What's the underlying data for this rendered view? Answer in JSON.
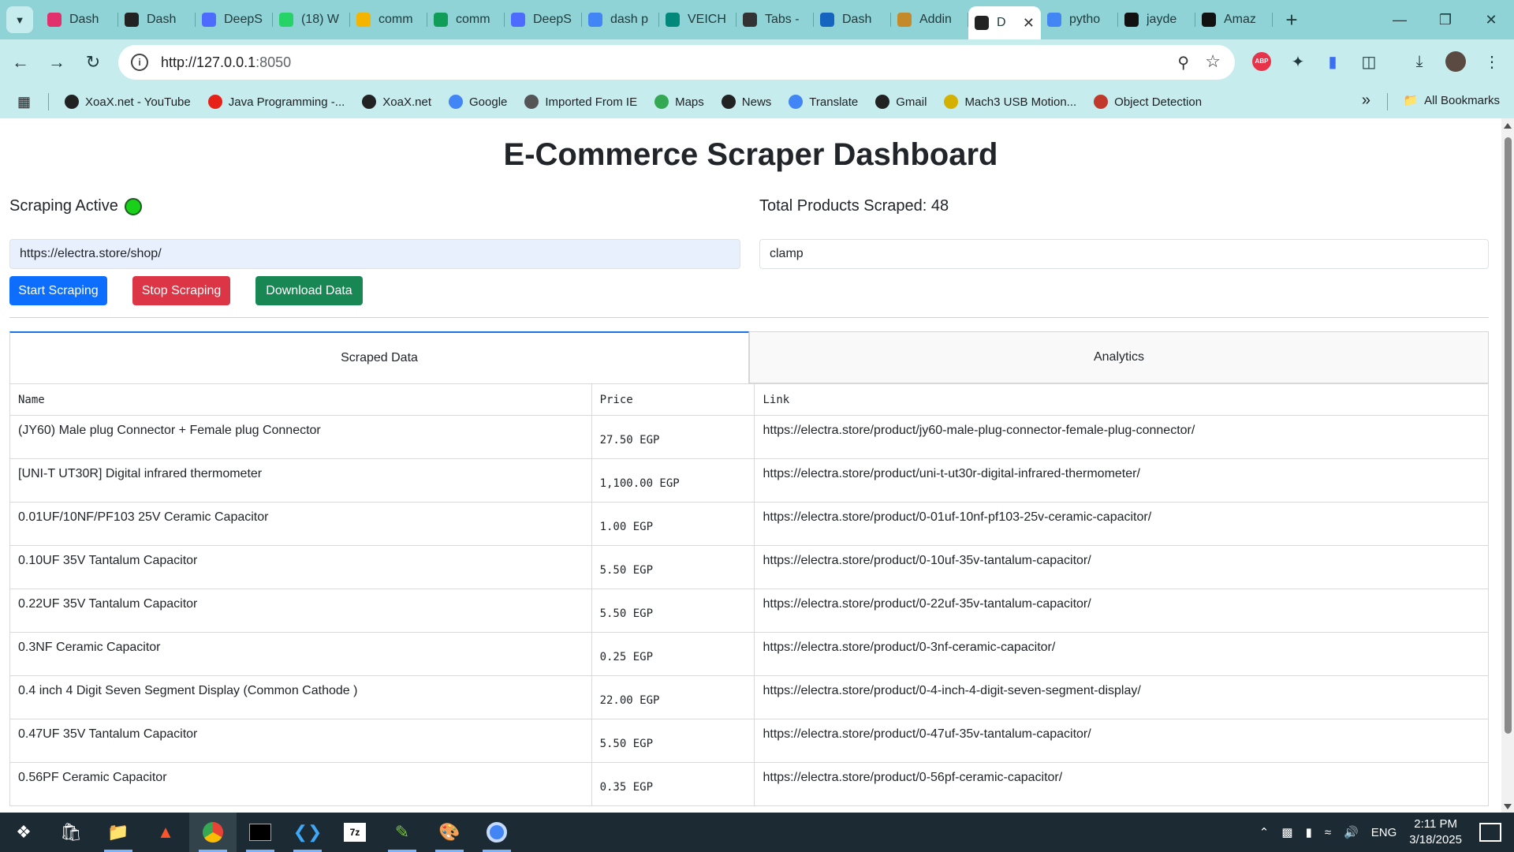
{
  "browser": {
    "tabs": [
      {
        "label": "Dash",
        "icon": "instagram-like-icon",
        "color": "#e1306c"
      },
      {
        "label": "Dash",
        "icon": "dash-icon",
        "color": "#222222"
      },
      {
        "label": "DeepS",
        "icon": "deepseek-icon",
        "color": "#4d6bfe"
      },
      {
        "label": "(18) W",
        "icon": "whatsapp-icon",
        "color": "#25d366"
      },
      {
        "label": "comm",
        "icon": "drive-icon",
        "color": "#f4b400"
      },
      {
        "label": "comm",
        "icon": "drive-icon",
        "color": "#0f9d58"
      },
      {
        "label": "DeepS",
        "icon": "deepseek-icon",
        "color": "#4d6bfe"
      },
      {
        "label": "dash p",
        "icon": "google-icon",
        "color": "#4285f4"
      },
      {
        "label": "VEICH",
        "icon": "v-icon",
        "color": "#00897b"
      },
      {
        "label": "Tabs -",
        "icon": "tabs-icon",
        "color": "#333333"
      },
      {
        "label": "Dash",
        "icon": "dmc-icon",
        "color": "#1565c0"
      },
      {
        "label": "Addin",
        "icon": "feather-icon",
        "color": "#c48a2a"
      }
    ],
    "active_tab": {
      "label": "D",
      "icon": "dash-icon"
    },
    "tabs_after": [
      {
        "label": "pytho",
        "icon": "google-icon",
        "color": "#4285f4"
      },
      {
        "label": "jayde",
        "icon": "github-icon",
        "color": "#111111"
      },
      {
        "label": "Amaz",
        "icon": "amazon-icon",
        "color": "#111111"
      }
    ],
    "url_host": "http://127.0.0.1",
    "url_port": ":8050",
    "bookmarks": [
      {
        "label": "XoaX.net - YouTube",
        "icon": "xoax-icon",
        "color": "#222222"
      },
      {
        "label": "Java Programming -...",
        "icon": "youtube-icon",
        "color": "#e62117"
      },
      {
        "label": "XoaX.net",
        "icon": "xoax-icon",
        "color": "#222222"
      },
      {
        "label": "Google",
        "icon": "google-icon",
        "color": "#4285f4"
      },
      {
        "label": "Imported From IE",
        "icon": "folder-icon",
        "color": "#555555"
      },
      {
        "label": "Maps",
        "icon": "maps-icon",
        "color": "#34a853"
      },
      {
        "label": "News",
        "icon": "globe-icon",
        "color": "#222222"
      },
      {
        "label": "Translate",
        "icon": "translate-icon",
        "color": "#4285f4"
      },
      {
        "label": "Gmail",
        "icon": "globe-icon",
        "color": "#222222"
      },
      {
        "label": "Mach3 USB Motion...",
        "icon": "mach3-icon",
        "color": "#d4b000"
      },
      {
        "label": "Object Detection",
        "icon": "ai-icon",
        "color": "#c0392b"
      }
    ],
    "all_bookmarks": "All Bookmarks"
  },
  "page": {
    "title": "E-Commerce Scraper Dashboard",
    "status_label": "Scraping Active",
    "status_color": "#1ad11a",
    "total_label": "Total Products Scraped: 48",
    "url_input_value": "https://electra.store/shop/",
    "keyword_input_value": "clamp",
    "buttons": {
      "start": "Start Scraping",
      "stop": "Stop Scraping",
      "download": "Download Data"
    },
    "tabs": {
      "scraped": "Scraped Data",
      "analytics": "Analytics"
    },
    "table": {
      "columns": [
        "Name",
        "Price",
        "Link"
      ],
      "rows": [
        {
          "name": "(JY60) Male plug Connector + Female plug Connector",
          "price": "27.50 EGP",
          "link": "https://electra.store/product/jy60-male-plug-connector-female-plug-connector/"
        },
        {
          "name": "[UNI-T UT30R] Digital infrared thermometer",
          "price": "1,100.00 EGP",
          "link": "https://electra.store/product/uni-t-ut30r-digital-infrared-thermometer/"
        },
        {
          "name": "0.01UF/10NF/PF103 25V Ceramic Capacitor",
          "price": "1.00 EGP",
          "link": "https://electra.store/product/0-01uf-10nf-pf103-25v-ceramic-capacitor/"
        },
        {
          "name": "0.10UF 35V Tantalum Capacitor",
          "price": "5.50 EGP",
          "link": "https://electra.store/product/0-10uf-35v-tantalum-capacitor/"
        },
        {
          "name": "0.22UF 35V Tantalum Capacitor",
          "price": "5.50 EGP",
          "link": "https://electra.store/product/0-22uf-35v-tantalum-capacitor/"
        },
        {
          "name": "0.3NF Ceramic Capacitor",
          "price": "0.25 EGP",
          "link": "https://electra.store/product/0-3nf-ceramic-capacitor/"
        },
        {
          "name": "0.4 inch 4 Digit Seven Segment Display (Common Cathode )",
          "price": "22.00 EGP",
          "link": "https://electra.store/product/0-4-inch-4-digit-seven-segment-display/"
        },
        {
          "name": "0.47UF 35V Tantalum Capacitor",
          "price": "5.50 EGP",
          "link": "https://electra.store/product/0-47uf-35v-tantalum-capacitor/"
        },
        {
          "name": "0.56PF Ceramic Capacitor",
          "price": "0.35 EGP",
          "link": "https://electra.store/product/0-56pf-ceramic-capacitor/"
        }
      ]
    }
  },
  "taskbar": {
    "lang": "ENG",
    "time": "2:11 PM",
    "date": "3/18/2025"
  }
}
